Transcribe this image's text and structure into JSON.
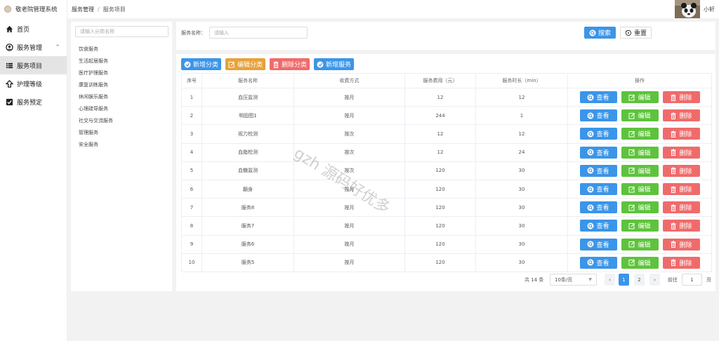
{
  "app": {
    "title": "敬老院管理系统"
  },
  "user": {
    "name": "小轩"
  },
  "breadcrumb": {
    "parent": "服务管理",
    "separator": "/",
    "current": "服务项目"
  },
  "sidebar": {
    "items": [
      {
        "label": "首页"
      },
      {
        "label": "服务管理"
      },
      {
        "label": "服务项目"
      },
      {
        "label": "护理等级"
      },
      {
        "label": "服务预定"
      }
    ]
  },
  "categories": {
    "search_placeholder": "请输入分类名称",
    "items": [
      "饮食服务",
      "生活起居服务",
      "医疗护理服务",
      "康复训练服务",
      "休闲娱乐服务",
      "心理疏导服务",
      "社交与交流服务",
      "管理服务",
      "安全服务"
    ]
  },
  "filter": {
    "label": "服务名称：",
    "placeholder": "请输入",
    "search_label": "搜索",
    "reset_label": "重置"
  },
  "toolbar": {
    "add_category": "新增分类",
    "edit_category": "编辑分类",
    "delete_category": "删除分类",
    "add_service": "新增服务"
  },
  "table": {
    "headers": [
      "序号",
      "服务名称",
      "收费方式",
      "服务费用（元）",
      "服务时长（min）",
      "操作"
    ],
    "rows": [
      {
        "no": "1",
        "name": "血压监测",
        "charge": "按月",
        "fee": "12",
        "duration": "12"
      },
      {
        "no": "2",
        "name": "明固图1",
        "charge": "按月",
        "fee": "244",
        "duration": "1"
      },
      {
        "no": "3",
        "name": "视力检测",
        "charge": "按次",
        "fee": "12",
        "duration": "12"
      },
      {
        "no": "4",
        "name": "血脂检测",
        "charge": "按次",
        "fee": "12",
        "duration": "24"
      },
      {
        "no": "5",
        "name": "血糖监测",
        "charge": "按次",
        "fee": "120",
        "duration": "30"
      },
      {
        "no": "6",
        "name": "翻身",
        "charge": "按月",
        "fee": "120",
        "duration": "30"
      },
      {
        "no": "7",
        "name": "服务8",
        "charge": "按月",
        "fee": "120",
        "duration": "30"
      },
      {
        "no": "8",
        "name": "服务7",
        "charge": "按月",
        "fee": "120",
        "duration": "30"
      },
      {
        "no": "9",
        "name": "服务6",
        "charge": "按月",
        "fee": "120",
        "duration": "30"
      },
      {
        "no": "10",
        "name": "服务5",
        "charge": "按月",
        "fee": "120",
        "duration": "30"
      }
    ],
    "actions": {
      "view": "查看",
      "edit": "编辑",
      "delete": "删除"
    }
  },
  "pagination": {
    "total": "共 14 条",
    "page_size": "10条/页",
    "pages": [
      "1",
      "2"
    ],
    "current_page": "1",
    "goto_label": "前往",
    "goto_value": "1",
    "page_label": "页"
  },
  "watermark": "gzh 源码好优多",
  "colors": {
    "primary": "#3b95e8",
    "warning": "#e6a23c",
    "danger": "#ef6b6b",
    "success": "#5ec33c"
  }
}
